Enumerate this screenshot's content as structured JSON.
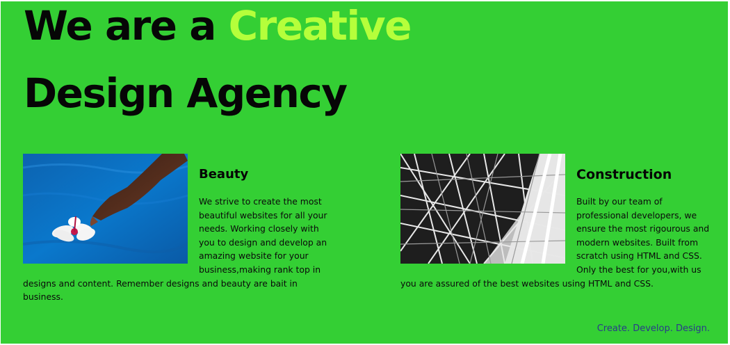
{
  "hero": {
    "line1_prefix": "We are a",
    "line1_accent": "Creative",
    "line2": "Design Agency"
  },
  "colors": {
    "background": "#34cf34",
    "accent": "#b5ff3b",
    "heading": "#060606",
    "tagline": "#2a3a8a"
  },
  "cards": [
    {
      "title": "Beauty",
      "image_icon": "flower-water-photo",
      "body": "We strive to create the most beautiful websites for all your needs. Working closely with you to design and develop an amazing website for your business,making rank top in designs and content. Remember designs and beauty are bait in business."
    },
    {
      "title": "Construction",
      "image_icon": "steel-structure-photo",
      "body": "Built by our team of professional developers, we ensure the most rigourous and modern websites. Built from scratch using HTML and CSS. Only the best for you,with us you are assured of the best websites using HTML and CSS."
    }
  ],
  "footer": {
    "tagline": "Create. Develop. Design."
  }
}
